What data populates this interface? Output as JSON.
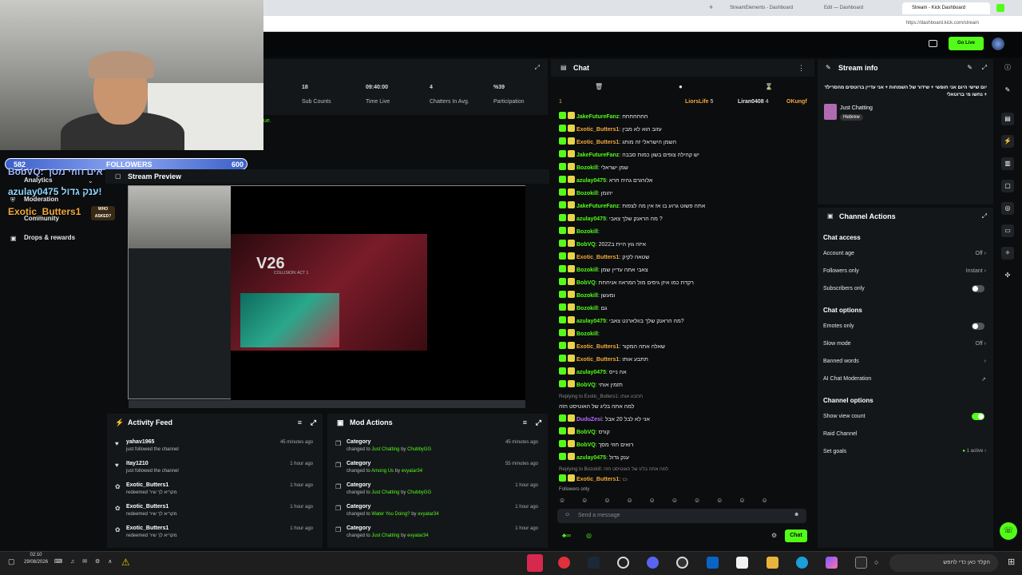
{
  "browser": {
    "tabs": [
      "StreamElements - Dashboard",
      "Edit — Dashboard",
      "Stream - Kick Dashboard"
    ],
    "url": "https://dashboard.kick.com/stream"
  },
  "topbar": {
    "go_live": "Go Live"
  },
  "overlay": {
    "followers_current": "582",
    "followers_label": "FOLLOWERS",
    "followers_goal": "600",
    "followers_progress": 0.97,
    "lines": [
      "BobVQ: ראים חוזי מסך",
      "azulay0475 ענק גדול!",
      "Exotic_Butters1"
    ],
    "logo_text": "WHO ASKED?"
  },
  "sidebar": {
    "items": [
      "Analytics",
      "Moderation",
      "Community",
      "Drops & rewards"
    ]
  },
  "stats": [
    {
      "value": "18",
      "label": "Sub Counts"
    },
    {
      "value": "09:40:00",
      "label": "Time Live"
    },
    {
      "value": "4",
      "label": "Chatters In Avg."
    },
    {
      "value": "%39",
      "label": "Participation"
    }
  ],
  "stats_partial_text": "ue.",
  "preview": {
    "title": "Stream Preview",
    "logo": "V26",
    "subtitle": "COLLISION: ACT 1"
  },
  "activity": {
    "title": "Activity Feed",
    "items": [
      {
        "user": "yahav1965",
        "desc": "just followed the channel",
        "time": "45 minutes ago"
      },
      {
        "user": "Itay1210",
        "desc": "just followed the channel",
        "time": "1 hour ago"
      },
      {
        "user": "Exotic_Butters1",
        "desc": "redeemed מקריא לך שיר",
        "time": "1 hour ago"
      },
      {
        "user": "Exotic_Butters1",
        "desc": "redeemed מקריא לך שיר",
        "time": "1 hour ago"
      },
      {
        "user": "Exotic_Butters1",
        "desc": "redeemed מקריא לך שיר",
        "time": "1 hour ago"
      }
    ]
  },
  "mod": {
    "title": "Mod Actions",
    "items": [
      {
        "title": "Category",
        "prefix": "changed to",
        "target": "Just Chatting",
        "by": "by",
        "user": "ChubbyGG",
        "time": "45 minutes ago"
      },
      {
        "title": "Category",
        "prefix": "changed to",
        "target": "Among Us",
        "by": "by",
        "user": "evyatar34",
        "time": "55 minutes ago"
      },
      {
        "title": "Category",
        "prefix": "changed to",
        "target": "Just Chatting",
        "by": "by",
        "user": "ChubbyGG",
        "time": "1 hour ago"
      },
      {
        "title": "Category",
        "prefix": "changed to",
        "target": "Water You Doing?",
        "by": "by",
        "user": "evyatar34",
        "time": "1 hour ago"
      },
      {
        "title": "Category",
        "prefix": "changed to",
        "target": "Just Chatting",
        "by": "by",
        "user": "evyatar34",
        "time": "1 hour ago"
      }
    ]
  },
  "chat": {
    "title": "Chat",
    "pinned": [
      {
        "name": "LiorsLife",
        "count": "5"
      },
      {
        "name": "Liran0408",
        "count": "4"
      },
      {
        "name": "OKungf",
        "count": ""
      }
    ],
    "pinned_count": "1",
    "messages": [
      {
        "user": "JakeFutureFanz",
        "color": "#53fc18",
        "text": "חחחחחחח"
      },
      {
        "user": "Exotic_Butters1",
        "color": "#f2a93b",
        "text": "עזוב הוא לא מבין"
      },
      {
        "user": "Exotic_Butters1",
        "color": "#f2a93b",
        "text": "השמן הישראלי זה מותג"
      },
      {
        "user": "JakeFutureFanz",
        "color": "#53fc18",
        "text": "יש קהילה צופים בשון כמות סבבה"
      },
      {
        "user": "Bozokill",
        "color": "#53fc18",
        "text": "שמן ישראלי"
      },
      {
        "user": "azulay0475",
        "color": "#53fc18",
        "text": "אלורגרם גהיה חרא"
      },
      {
        "user": "Bozokill",
        "color": "#53fc18",
        "text": "יהומן"
      },
      {
        "user": "JakeFutureFanz",
        "color": "#53fc18",
        "text": "אתה פשוט גרוע בו אז אין מה לצפות"
      },
      {
        "user": "azulay0475",
        "color": "#53fc18",
        "text": "מה הראנק שלך צאבי ?"
      },
      {
        "user": "Bozokill",
        "color": "#53fc18",
        "text": ""
      },
      {
        "user": "BobVQ",
        "color": "#53fc18",
        "text": "איזה גוץ היית ב2022"
      },
      {
        "user": "Exotic_Butters1",
        "color": "#f2a93b",
        "text": "שטאה לקיק"
      },
      {
        "user": "Bozokill",
        "color": "#53fc18",
        "text": "צאבי אתה עדיין שמן"
      },
      {
        "user": "BobVQ",
        "color": "#53fc18",
        "text": "רקדת כמו איזן גיסים מול המראה אניחחת"
      },
      {
        "user": "Bozokill",
        "color": "#53fc18",
        "text": "ומעשן"
      },
      {
        "user": "Bozokill",
        "color": "#53fc18",
        "text": "גם"
      },
      {
        "user": "azulay0475",
        "color": "#53fc18",
        "text": "מה הראנק שלך בוולארנט צאבי?"
      },
      {
        "user": "Bozokill",
        "color": "#53fc18",
        "text": ""
      },
      {
        "user": "Exotic_Butters1",
        "color": "#f2a93b",
        "text": "שאלה אתה המקור"
      },
      {
        "user": "Exotic_Butters1",
        "color": "#f2a93b",
        "text": "תתבע אותו"
      },
      {
        "user": "azulay0475",
        "color": "#53fc18",
        "text": "אה נייס"
      },
      {
        "user": "BobVQ",
        "color": "#53fc18",
        "text": "תזמין אותי"
      }
    ],
    "reply1": "Replying to Exotic_Butters1: תתבע אותו",
    "reply1_msg": "למה אתה בליג של האוטיסט הזה",
    "messages2": [
      {
        "user": "DuduZesi",
        "color": "#b36bff",
        "text": "אני לא לבל 20 אבל"
      },
      {
        "user": "BobVQ",
        "color": "#53fc18",
        "text": "קורס"
      },
      {
        "user": "BobVQ",
        "color": "#53fc18",
        "text": "רואים חוזי מסך"
      },
      {
        "user": "azulay0475",
        "color": "#53fc18",
        "text": "ענק גדול"
      }
    ],
    "reply2": "Replying to BozokiIl: למה אתה בליג של האוטיסט הזה",
    "last": {
      "user": "Exotic_Butters1",
      "color": "#f2a93b"
    },
    "followers_only": "Followers only",
    "placeholder": "Send a message",
    "send": "Chat"
  },
  "stream_info": {
    "title": "Stream info",
    "stream_title": "יום שישי היום אני חופשי + שידור של השמחות + אני עדיין ברוטסים מהסרילד + נחשו מי ברוטאלי",
    "category": "Just Chatting",
    "tag": "Hebrew"
  },
  "channel_actions": {
    "title": "Channel Actions",
    "chat_access": "Chat access",
    "account_age": "Account age",
    "account_age_value": "Off",
    "followers_only": "Followers only",
    "followers_only_value": "Instant",
    "subscribers_only": "Subscribers only",
    "chat_options": "Chat options",
    "emotes_only": "Emotes only",
    "slow_mode": "Slow mode",
    "slow_mode_value": "Off",
    "banned_words": "Banned words",
    "ai_moderation": "AI Chat Moderation",
    "channel_options": "Channel options",
    "show_view_count": "Show view count",
    "raid_channel": "Raid Channel",
    "set_goals": "Set goals",
    "set_goals_value": "1 active"
  },
  "taskbar": {
    "time": "02:10",
    "date": "29/08/2026",
    "search": "הקלד כאן כדי לחפש"
  },
  "colors": {
    "accent": "#53fc18",
    "panel": "#14171a",
    "bg": "#0b0d0e"
  }
}
